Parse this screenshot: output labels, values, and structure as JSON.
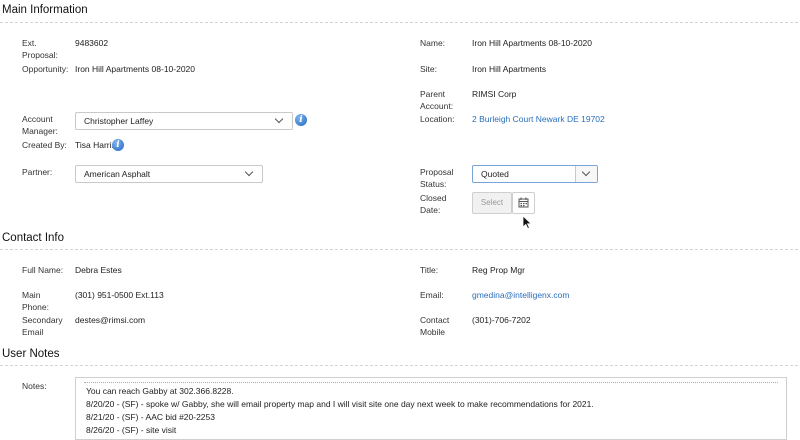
{
  "main_info": {
    "title": "Main Information",
    "ext_proposal": {
      "label": "Ext. Proposal:",
      "value": "9483602"
    },
    "opportunity": {
      "label": "Opportunity:",
      "value": "Iron Hill Apartments 08-10-2020"
    },
    "name": {
      "label": "Name:",
      "value": "Iron Hill Apartments 08-10-2020"
    },
    "site": {
      "label": "Site:",
      "value": "Iron Hill Apartments"
    },
    "parent_account": {
      "label": "Parent Account:",
      "value": "RIMSI Corp"
    },
    "account_manager": {
      "label": "Account Manager:",
      "value": "Christopher Laffey"
    },
    "location": {
      "label": "Location:",
      "value": "2 Burleigh Court Newark DE 19702"
    },
    "created_by": {
      "label": "Created By:",
      "value": "Tisa Harris"
    },
    "partner": {
      "label": "Partner:",
      "value": "American Asphalt"
    },
    "proposal_status": {
      "label": "Proposal Status:",
      "value": "Quoted"
    },
    "closed_date": {
      "label": "Closed Date:",
      "placeholder": "Select"
    }
  },
  "contact_info": {
    "title": "Contact Info",
    "full_name": {
      "label": "Full Name:",
      "value": "Debra Estes"
    },
    "title_field": {
      "label": "Title:",
      "value": "Reg Prop Mgr"
    },
    "main_phone": {
      "label": "Main Phone:",
      "value": "(301) 951-0500 Ext.113"
    },
    "email": {
      "label": "Email:",
      "value": "gmedina@intelligenx.com"
    },
    "secondary_email": {
      "label": "Secondary Email",
      "value": "destes@rimsi.com"
    },
    "contact_mobile": {
      "label": "Contact Mobile",
      "value": "(301)-706-7202"
    }
  },
  "user_notes": {
    "title": "User Notes",
    "label": "Notes:",
    "lines": [
      "You can reach Gabby at 302.366.8228.",
      "8/20/20 - (SF) - spoke w/ Gabby, she will email property map and I will visit site one day next week to make recommendations for 2021.",
      "8/21/20 - (SF) - AAC bid #20-2253",
      "8/26/20 - (SF) - site visit"
    ]
  },
  "colors": {
    "link": "#2a6fbb",
    "info_icon": "#2167c2"
  },
  "icons": {
    "info": "info-icon",
    "calendar": "calendar-icon",
    "dropdown": "chevron-down-icon"
  }
}
